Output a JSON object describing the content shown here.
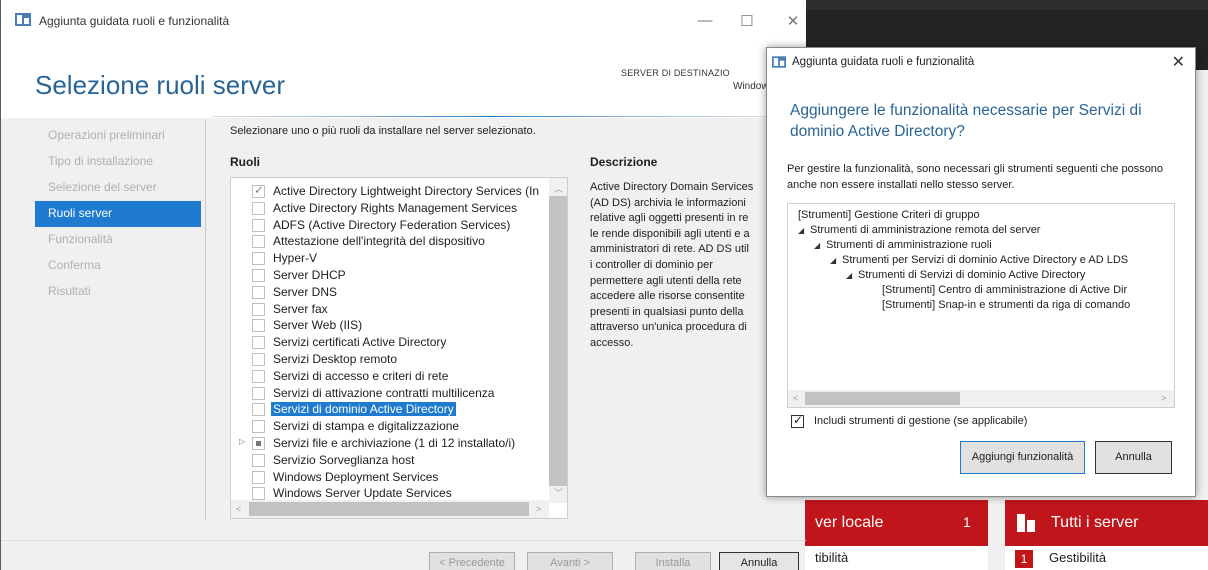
{
  "wizard": {
    "window_title": "Aggiunta guidata ruoli e funzionalità",
    "window_controls": {
      "minimize": "—",
      "maximize": "☐",
      "close": "✕"
    },
    "page_heading": "Selezione ruoli server",
    "destination_label": "SERVER DI DESTINAZIO",
    "destination_value": "Windows",
    "nav": [
      {
        "label": "Operazioni preliminari",
        "active": false
      },
      {
        "label": "Tipo di installazione",
        "active": false
      },
      {
        "label": "Selezione del server",
        "active": false
      },
      {
        "label": "Ruoli server",
        "active": true
      },
      {
        "label": "Funzionalità",
        "active": false
      },
      {
        "label": "Conferma",
        "active": false
      },
      {
        "label": "Risultati",
        "active": false
      }
    ],
    "instruction": "Selezionare uno o più ruoli da installare nel server selezionato.",
    "roles_label": "Ruoli",
    "description_label": "Descrizione",
    "roles": [
      {
        "label": "Active Directory Lightweight Directory Services (In",
        "state": "checked"
      },
      {
        "label": "Active Directory Rights Management Services",
        "state": "unchecked"
      },
      {
        "label": "ADFS (Active Directory Federation Services)",
        "state": "unchecked"
      },
      {
        "label": "Attestazione dell'integrità del dispositivo",
        "state": "unchecked"
      },
      {
        "label": "Hyper-V",
        "state": "unchecked"
      },
      {
        "label": "Server DHCP",
        "state": "unchecked"
      },
      {
        "label": "Server DNS",
        "state": "unchecked"
      },
      {
        "label": "Server fax",
        "state": "unchecked"
      },
      {
        "label": "Server Web (IIS)",
        "state": "unchecked"
      },
      {
        "label": "Servizi certificati Active Directory",
        "state": "unchecked"
      },
      {
        "label": "Servizi Desktop remoto",
        "state": "unchecked"
      },
      {
        "label": "Servizi di accesso e criteri di rete",
        "state": "unchecked"
      },
      {
        "label": "Servizi di attivazione contratti multilicenza",
        "state": "unchecked"
      },
      {
        "label": "Servizi di dominio Active Directory",
        "state": "selected"
      },
      {
        "label": "Servizi di stampa e digitalizzazione",
        "state": "unchecked"
      },
      {
        "label": "Servizi file e archiviazione (1 di 12 installato/i)",
        "state": "partial"
      },
      {
        "label": "Servizio Sorveglianza host",
        "state": "unchecked"
      },
      {
        "label": "Windows Deployment Services",
        "state": "unchecked"
      },
      {
        "label": "Windows Server Update Services",
        "state": "unchecked"
      }
    ],
    "description": "Active Directory Domain Services\n(AD DS) archivia le informazioni\nrelative agli oggetti presenti in re\nle rende disponibili agli utenti e a\namministratori di rete. AD DS util\ni controller di dominio per\npermettere agli utenti della rete\naccedere alle risorse consentite\npresenti in qualsiasi punto della\nattraverso un'unica procedura di\naccesso.",
    "buttons": {
      "previous": "< Precedente",
      "next": "Avanti >",
      "install": "Installa",
      "cancel": "Annulla"
    }
  },
  "background": {
    "tile_local_title": "ver locale",
    "tile_local_count": "1",
    "tile_local_row": "tibilità",
    "tile_all_title": "Tutti i server",
    "tile_all_badge": "1",
    "tile_all_row": "Gestibilità"
  },
  "dialog": {
    "title": "Aggiunta guidata ruoli e funzionalità",
    "close": "✕",
    "heading": "Aggiungere le funzionalità necessarie per Servizi di dominio Active Directory?",
    "text": "Per gestire la funzionalità, sono necessari gli strumenti seguenti che possono anche non essere installati nello stesso server.",
    "tree": [
      {
        "label": "[Strumenti] Gestione Criteri di gruppo",
        "expanded": false
      },
      {
        "label": "Strumenti di amministrazione remota del server",
        "expanded": true
      },
      {
        "label": "Strumenti di amministrazione ruoli",
        "expanded": true
      },
      {
        "label": "Strumenti per Servizi di dominio Active Directory e AD LDS",
        "expanded": true
      },
      {
        "label": "Strumenti di Servizi di dominio Active Directory",
        "expanded": true
      },
      {
        "label": "[Strumenti] Centro di amministrazione di Active Dir",
        "expanded": false
      },
      {
        "label": "[Strumenti] Snap-in e strumenti da riga di comando",
        "expanded": false
      }
    ],
    "include_tools_label": "Includi strumenti di gestione (se applicabile)",
    "include_tools_checked": true,
    "add_button": "Aggiungi funzionalità",
    "cancel_button": "Annulla"
  },
  "colors": {
    "accent": "#1e7bd0",
    "heading": "#2a6496",
    "tile_red": "#c0151b"
  }
}
